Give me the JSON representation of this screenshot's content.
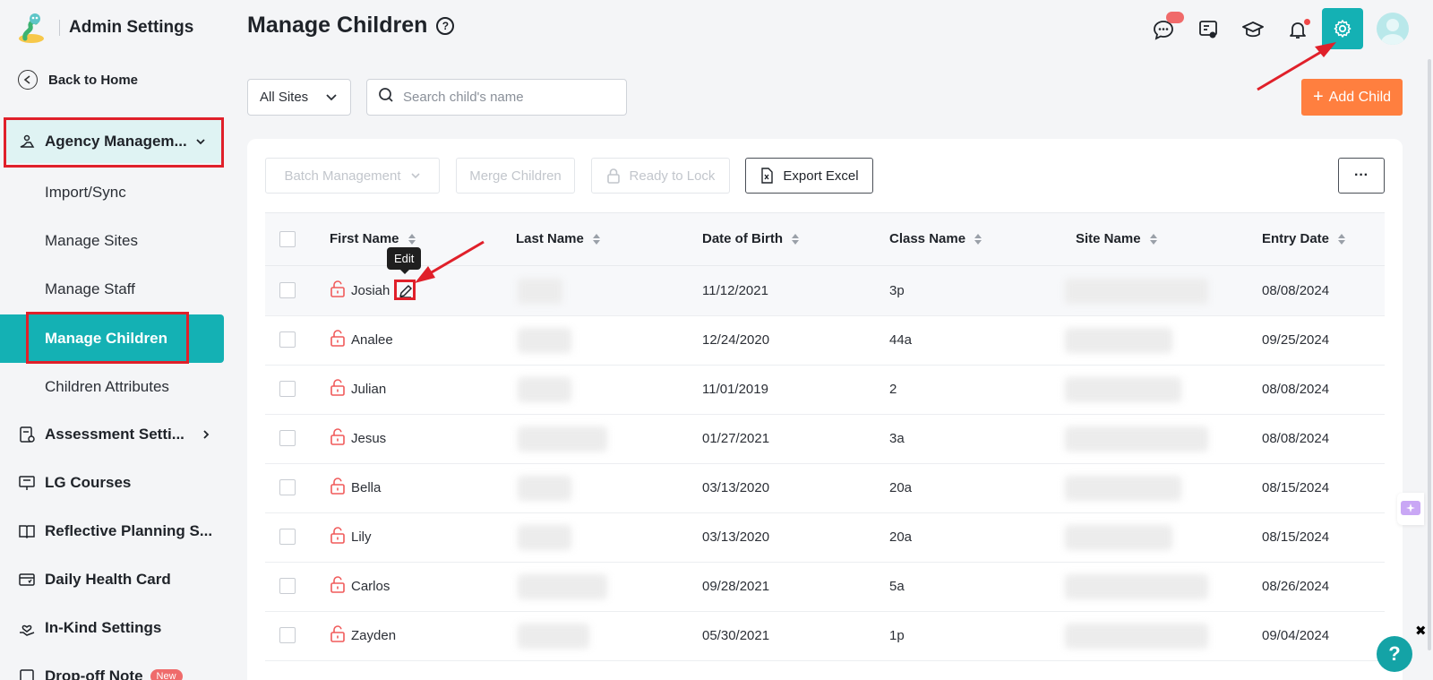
{
  "sidebar": {
    "brand_title": "Admin Settings",
    "back_home": "Back to Home",
    "agency_management": "Agency Managem...",
    "sub_items": [
      "Import/Sync",
      "Manage Sites",
      "Manage Staff",
      "Manage Children",
      "Children Attributes"
    ],
    "assessment_settings": "Assessment Setti...",
    "lg_courses": "LG Courses",
    "reflective_planning": "Reflective Planning S...",
    "daily_health_card": "Daily Health Card",
    "in_kind_settings": "In-Kind Settings",
    "drop_off_note": "Drop-off Note",
    "new_badge": "New"
  },
  "header": {
    "title": "Manage Children",
    "help_glyph": "?"
  },
  "filters": {
    "site_select": "All Sites",
    "search_placeholder": "Search child's name",
    "add_child_label": "Add Child",
    "add_child_plus": "+"
  },
  "toolbar": {
    "batch_management": "Batch Management",
    "merge_children": "Merge Children",
    "ready_to_lock": "Ready to Lock",
    "export_excel": "Export Excel",
    "more": "···"
  },
  "table": {
    "columns": [
      "First Name",
      "Last Name",
      "Date of Birth",
      "Class Name",
      "Site Name",
      "Entry Date"
    ],
    "rows": [
      {
        "first": "Josiah",
        "dob": "11/12/2021",
        "class": "3p",
        "entry": "08/08/2024"
      },
      {
        "first": "Analee",
        "dob": "12/24/2020",
        "class": "44a",
        "entry": "09/25/2024"
      },
      {
        "first": "Julian",
        "dob": "11/01/2019",
        "class": "2",
        "entry": "08/08/2024"
      },
      {
        "first": "Jesus",
        "dob": "01/27/2021",
        "class": "3a",
        "entry": "08/08/2024"
      },
      {
        "first": "Bella",
        "dob": "03/13/2020",
        "class": "20a",
        "entry": "08/15/2024"
      },
      {
        "first": "Lily",
        "dob": "03/13/2020",
        "class": "20a",
        "entry": "08/15/2024"
      },
      {
        "first": "Carlos",
        "dob": "09/28/2021",
        "class": "5a",
        "entry": "08/26/2024"
      },
      {
        "first": "Zayden",
        "dob": "05/30/2021",
        "class": "1p",
        "entry": "09/04/2024"
      }
    ]
  },
  "tooltip": "Edit",
  "help_fab": "?",
  "close_glyph": "✖",
  "colors": {
    "teal": "#14b1b4",
    "orange": "#ff7f3f",
    "annotation_red": "#e0202a",
    "lock_red": "#f05a5a"
  }
}
